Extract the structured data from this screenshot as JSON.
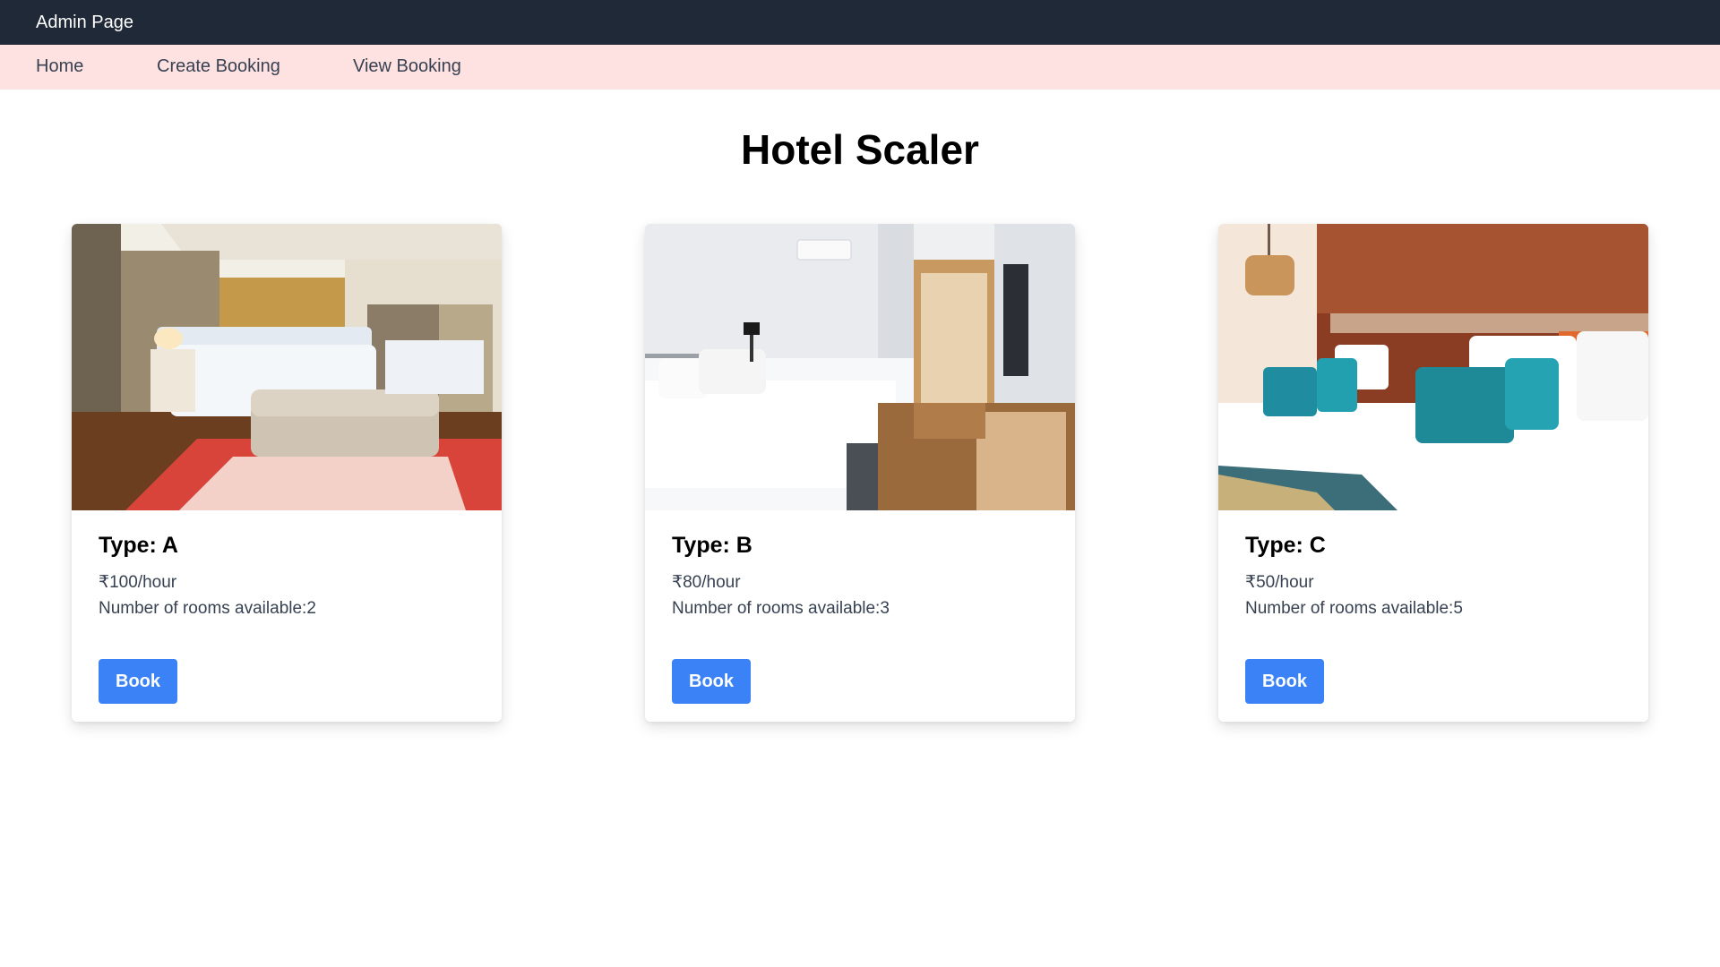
{
  "header": {
    "brand": "Admin Page"
  },
  "nav": {
    "home": "Home",
    "create_booking": "Create Booking",
    "view_booking": "View Booking"
  },
  "main": {
    "title": "Hotel Scaler",
    "rooms": [
      {
        "type": "Type: A",
        "price": "₹100/hour",
        "availability": "Number of rooms available:2",
        "button": "Book",
        "image_icon": "luxury-bedroom-photo"
      },
      {
        "type": "Type: B",
        "price": "₹80/hour",
        "availability": "Number of rooms available:3",
        "button": "Book",
        "image_icon": "modern-bedroom-photo"
      },
      {
        "type": "Type: C",
        "price": "₹50/hour",
        "availability": "Number of rooms available:5",
        "button": "Book",
        "image_icon": "teal-pillows-bedroom-photo"
      }
    ]
  },
  "colors": {
    "topbar": "#1f2937",
    "navbar": "#fee2e2",
    "button": "#3b82f6"
  }
}
